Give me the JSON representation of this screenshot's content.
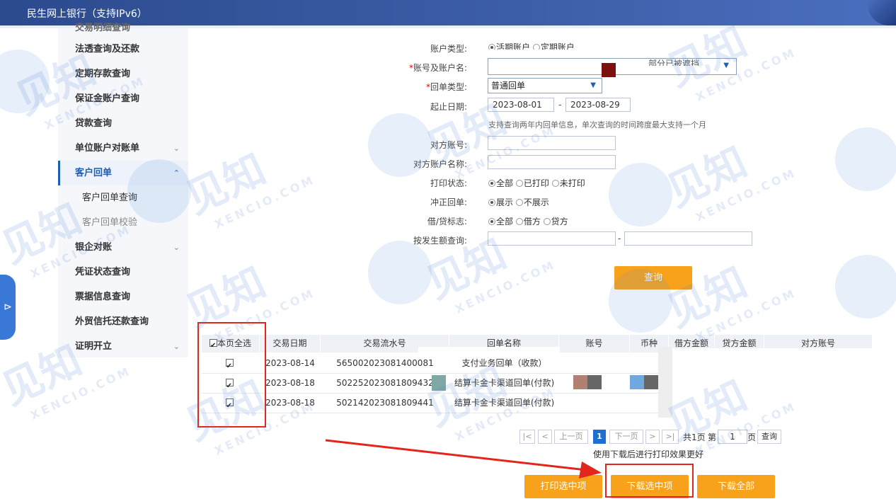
{
  "header": {
    "title": "民生网上银行（支持IPv6）"
  },
  "sidebar": {
    "items": [
      {
        "label": "交易明细查询"
      },
      {
        "label": "法透查询及还款"
      },
      {
        "label": "定期存款查询"
      },
      {
        "label": "保证金账户查询"
      },
      {
        "label": "贷款查询"
      },
      {
        "label": "单位账户对账单",
        "chevron": "⌄"
      },
      {
        "label": "客户回单",
        "chevron": "⌃"
      },
      {
        "label": "客户回单查询"
      },
      {
        "label": "客户回单校验"
      },
      {
        "label": "银企对账",
        "chevron": "⌄"
      },
      {
        "label": "凭证状态查询"
      },
      {
        "label": "票据信息查询"
      },
      {
        "label": "外贸信托还款查询"
      },
      {
        "label": "证明开立",
        "chevron": "⌄"
      }
    ]
  },
  "form": {
    "account_type": {
      "label": "账户类型:",
      "options": [
        "活期账户",
        "定期账户"
      ]
    },
    "account": {
      "label": "账号及账户名:",
      "select_text": "部分已被遮挡"
    },
    "receipt_type": {
      "label": "回单类型:",
      "value": "普通回单"
    },
    "date_range": {
      "label": "起止日期:",
      "start": "2023-08-01",
      "sep": "-",
      "end": "2023-08-29"
    },
    "hint": "支持查询两年内回单信息，单次查询的时间跨度最大支持一个月",
    "counter_account": {
      "label": "对方账号:"
    },
    "counter_name": {
      "label": "对方账户名称:"
    },
    "print_status": {
      "label": "打印状态:",
      "options": [
        "全部",
        "已打印",
        "未打印"
      ]
    },
    "reversal": {
      "label": "冲正回单:",
      "options": [
        "展示",
        "不展示"
      ]
    },
    "dc_flag": {
      "label": "借/贷标志:",
      "options": [
        "全部",
        "借方",
        "贷方"
      ]
    },
    "amount": {
      "label": "按发生额查询:",
      "sep": "-"
    },
    "query_button": "查询"
  },
  "table": {
    "headers": [
      "本页全选",
      "交易日期",
      "交易流水号",
      "回单名称",
      "账号",
      "币种",
      "借方金额",
      "贷方金额",
      "对方账号"
    ],
    "rows": [
      {
        "date": "2023-08-14",
        "serial": "565002023081400081",
        "name": "支付业务回单（收款）"
      },
      {
        "date": "2023-08-18",
        "serial": "502252023081809432",
        "name": "结算卡金卡渠道回单(付款)"
      },
      {
        "date": "2023-08-18",
        "serial": "502142023081809441",
        "name": "结算卡金卡渠道回单(付款)"
      }
    ]
  },
  "pagination": {
    "first": "|<",
    "prev_icon": "<",
    "prev": "上一页",
    "current": "1",
    "next": "下一页",
    "next_icon": ">",
    "last": ">|",
    "total_text": "共1页",
    "goto_prefix": "第",
    "goto_value": "1",
    "goto_suffix": "页",
    "go_button": "查询"
  },
  "tip": "使用下载后进行打印效果更好",
  "actions": {
    "print_selected": "打印选中项",
    "download_selected": "下载选中项",
    "download_all": "下载全部"
  },
  "watermark": {
    "big": "见知",
    "small": "XENCIO.COM"
  },
  "colors": {
    "header": "#2c4a8e",
    "accent": "#f7a21a",
    "annotation": "#e3261b",
    "active": "#1f5fb3"
  }
}
